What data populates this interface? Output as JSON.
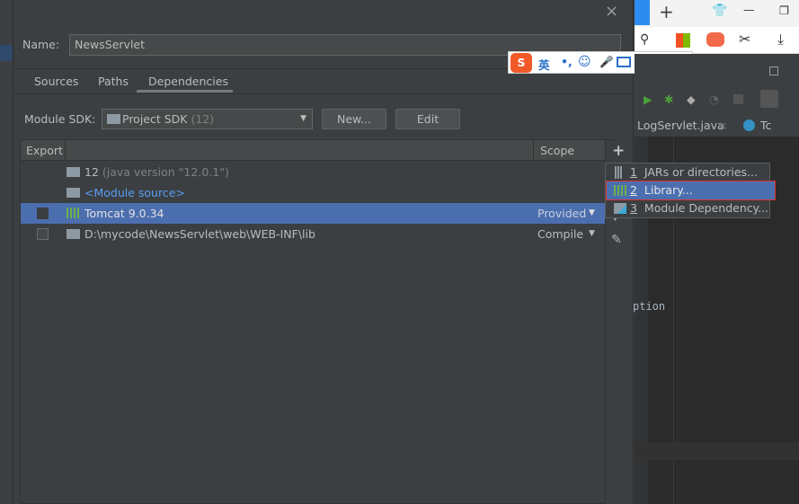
{
  "dialog": {
    "close": "×",
    "name_label": "Name:",
    "name_value": "NewsServlet",
    "tabs": [
      "Sources",
      "Paths",
      "Dependencies"
    ],
    "sdk_label": "Module SDK:",
    "sdk_value": "Project SDK",
    "sdk_version": "(12)",
    "new_button": "New...",
    "edit_button": "Edit",
    "table": {
      "headers": {
        "export": "Export",
        "scope": "Scope"
      },
      "rows": [
        {
          "name": "12",
          "detail": "(java version \"12.0.1\")",
          "scope": ""
        },
        {
          "name": "<Module source>",
          "detail": "",
          "scope": ""
        },
        {
          "name": "Tomcat 9.0.34",
          "detail": "",
          "scope": "Provided",
          "checked": false,
          "selected": true
        },
        {
          "name": "D:\\mycode\\NewsServlet\\web\\WEB-INF\\lib",
          "detail": "",
          "scope": "Compile",
          "checked": false
        }
      ]
    },
    "add_menu": [
      {
        "num": "1",
        "label": "JARs or directories..."
      },
      {
        "num": "2",
        "label": "Library..."
      },
      {
        "num": "3",
        "label": "Module Dependency..."
      }
    ]
  },
  "ide": {
    "tabs": [
      "LogServlet.java",
      "Tc"
    ],
    "code_fragment": "ption"
  },
  "ime": {
    "lang": "英",
    "punct": "•,"
  },
  "colors": {
    "selection": "#4b6eaf",
    "bg": "#3c3f41",
    "editor": "#2b2b2b",
    "link": "#589df6"
  }
}
